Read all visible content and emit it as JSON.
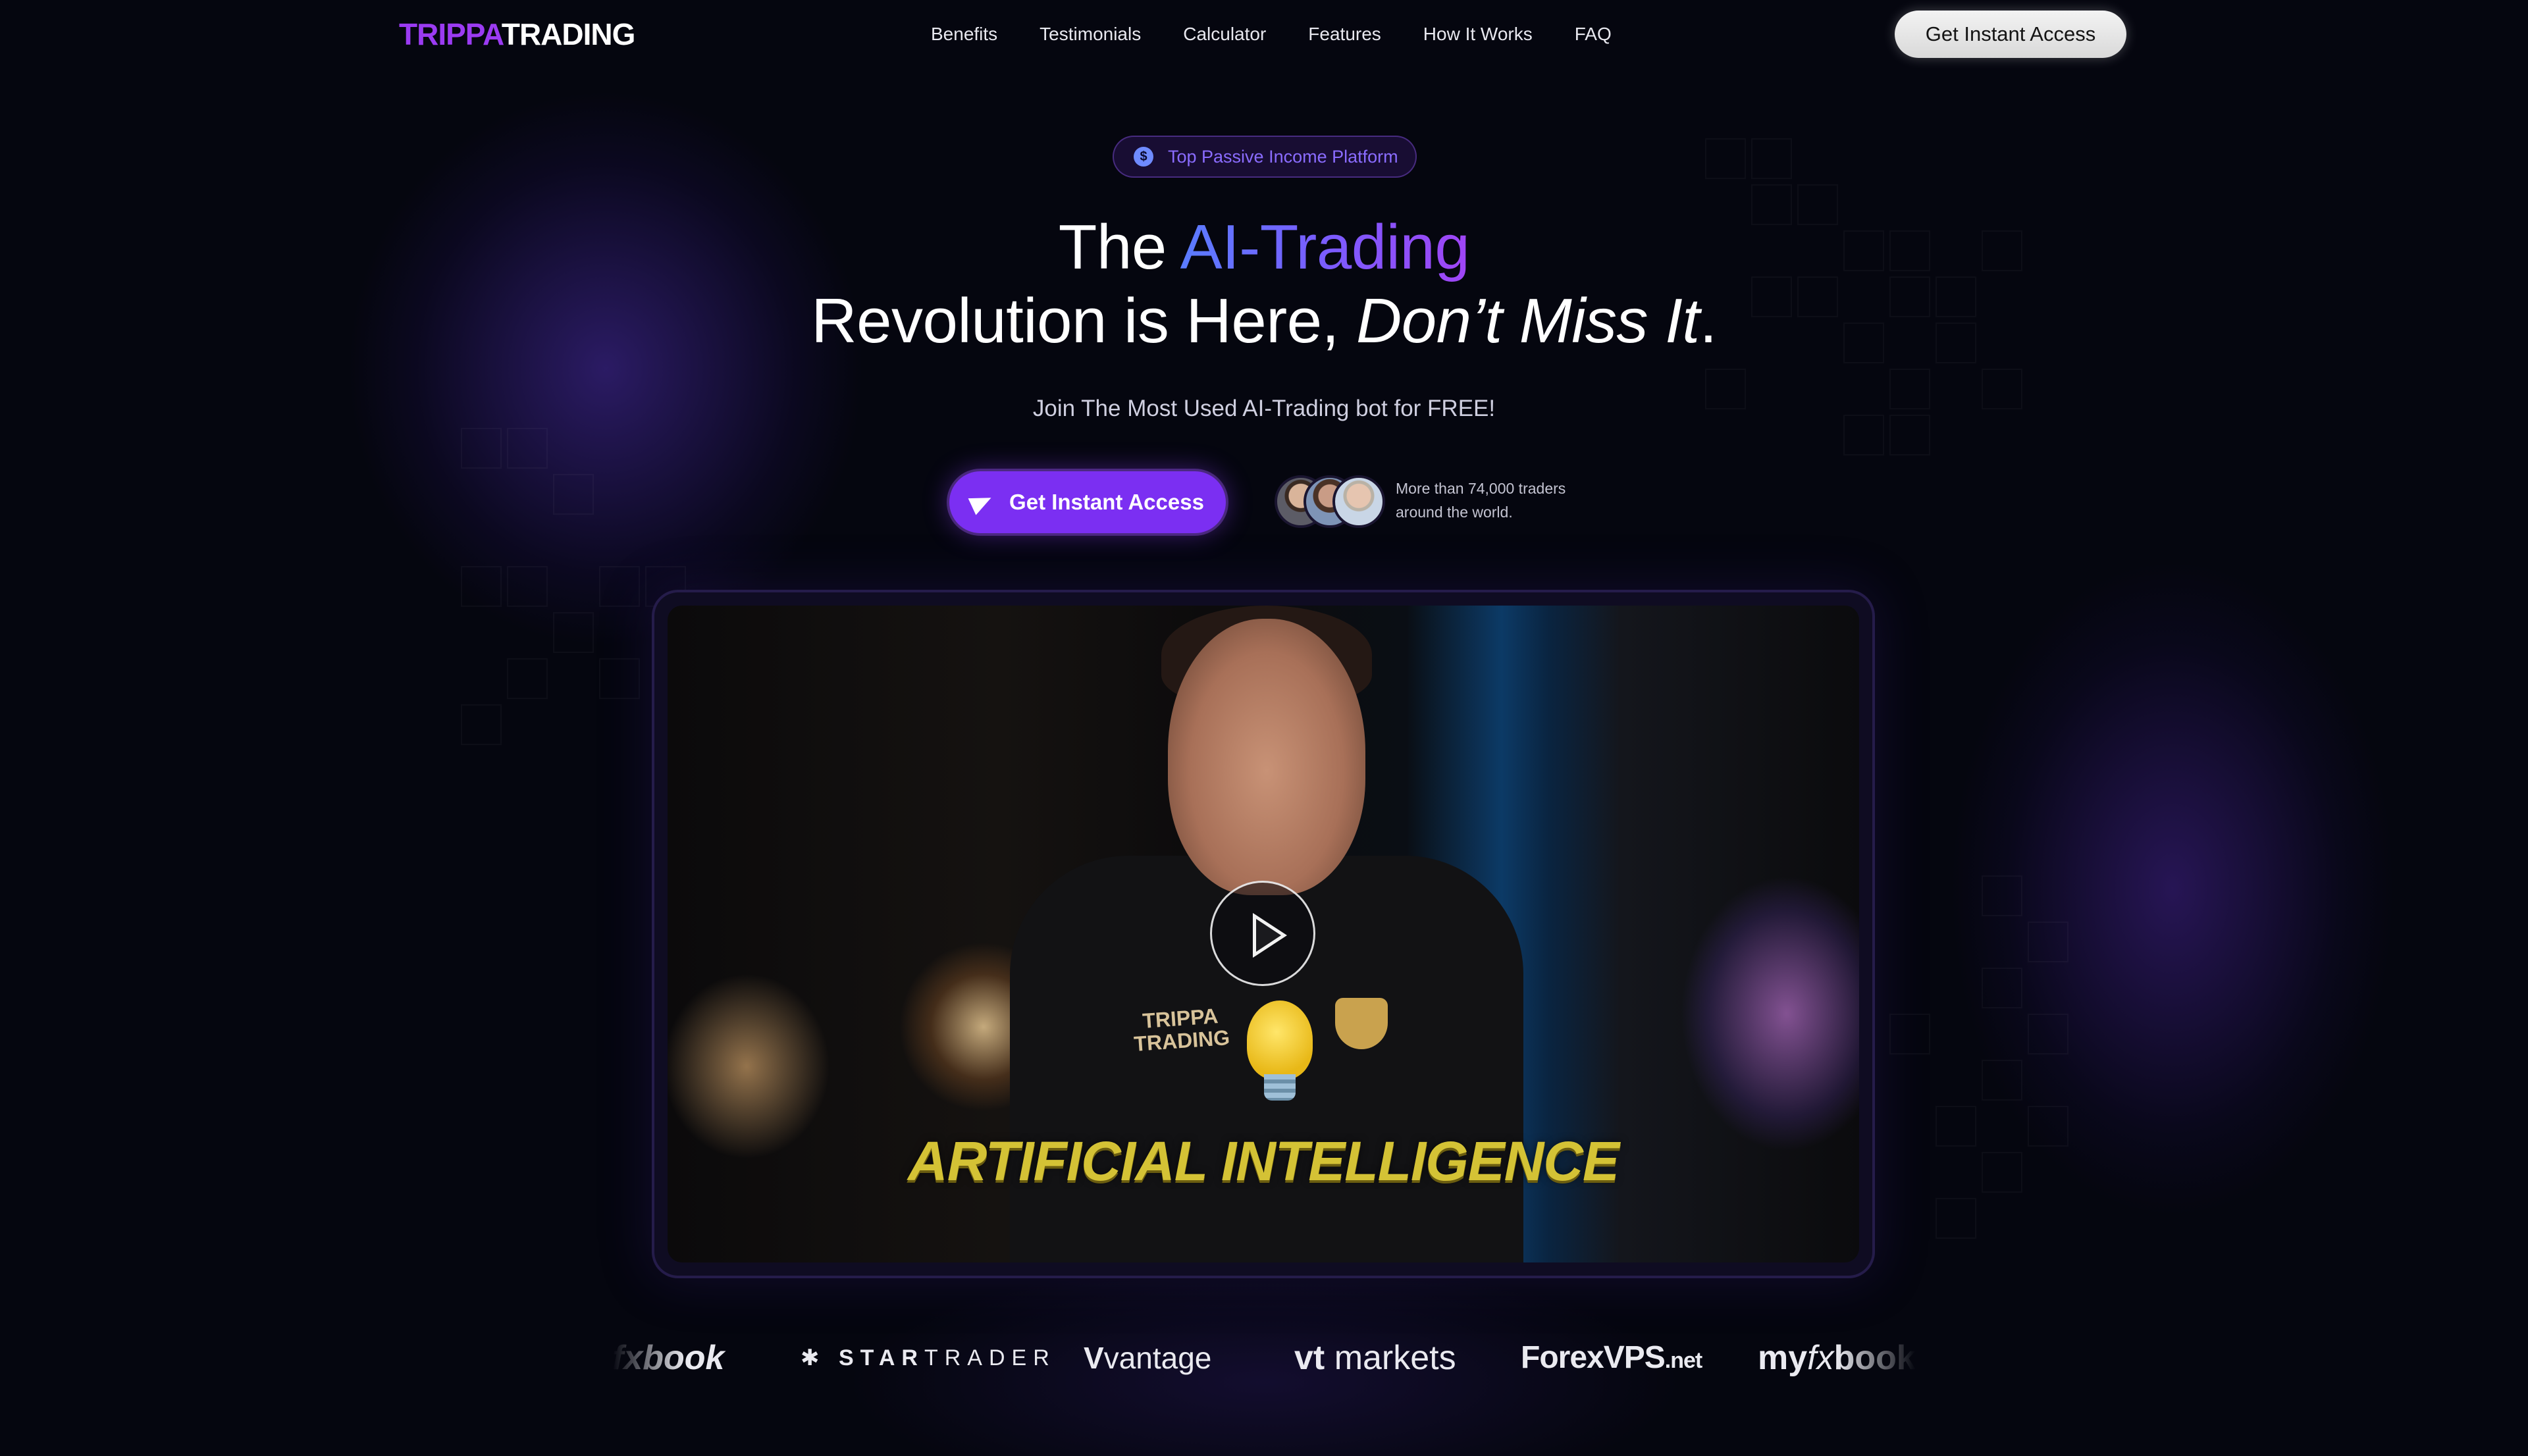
{
  "header": {
    "logo_part1": "TRIPPA",
    "logo_part2": "TRADING",
    "nav": [
      "Benefits",
      "Testimonials",
      "Calculator",
      "Features",
      "How It Works",
      "FAQ"
    ],
    "cta_label": "Get Instant Access"
  },
  "hero": {
    "badge_icon": "$",
    "badge_text": "Top Passive Income Platform",
    "headline_1a": "The ",
    "headline_1b": "AI-Trading",
    "headline_2a": "Revolution is Here, ",
    "headline_2b": "Don’t Miss It",
    "headline_2c": ".",
    "subheadline": "Join The Most Used AI-Trading bot for FREE!",
    "cta_label": "Get Instant Access",
    "social_proof_line1": "More than 74,000 traders",
    "social_proof_line2": "around the world."
  },
  "video": {
    "shirt_text_1": "TRIPPA",
    "shirt_text_2": "TRADING",
    "caption": "ARTIFICIAL INTELLIGENCE",
    "play_icon": "play-icon"
  },
  "partners": {
    "fxbook": "fxbook",
    "startrader_star": "✱",
    "startrader_a": "STAR",
    "startrader_b": "TRADER",
    "vantage_mark": "V",
    "vantage": "vantage",
    "vt_mark": "vt",
    "vt_text": " markets",
    "forexvps": "ForexVPS",
    "forexvps_tld": ".net",
    "myfx_a": "my",
    "myfx_b": "fx",
    "myfx_c": "book"
  },
  "colors": {
    "brand_purple": "#7b2ff2",
    "logo_purple": "#9b3bf2",
    "gradient_start": "#5a7cff",
    "gradient_end": "#a045f5",
    "background": "#05060f"
  }
}
